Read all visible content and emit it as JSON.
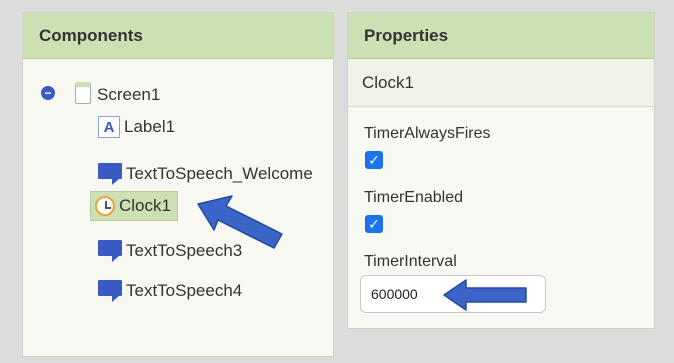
{
  "components": {
    "header": "Components",
    "tree": [
      {
        "label": "Screen1",
        "icon": "screen-icon",
        "collapse": "−"
      },
      {
        "label": "Label1",
        "icon": "label-icon",
        "icon_glyph": "A"
      },
      {
        "label": "TextToSpeech_Welcome",
        "icon": "text-to-speech-icon"
      },
      {
        "label": "Clock1",
        "icon": "clock-icon",
        "selected": true
      },
      {
        "label": "TextToSpeech3",
        "icon": "text-to-speech-icon"
      },
      {
        "label": "TextToSpeech4",
        "icon": "text-to-speech-icon"
      }
    ]
  },
  "properties": {
    "header": "Properties",
    "component_name": "Clock1",
    "items": [
      {
        "label": "TimerAlwaysFires",
        "type": "checkbox",
        "checked": true,
        "check_glyph": "✓"
      },
      {
        "label": "TimerEnabled",
        "type": "checkbox",
        "checked": true,
        "check_glyph": "✓"
      },
      {
        "label": "TimerInterval",
        "type": "text",
        "value": "600000"
      }
    ]
  },
  "colors": {
    "header_bg": "#cde0b3",
    "accent_blue": "#3a5bc4",
    "checkbox_blue": "#1a73e8"
  }
}
